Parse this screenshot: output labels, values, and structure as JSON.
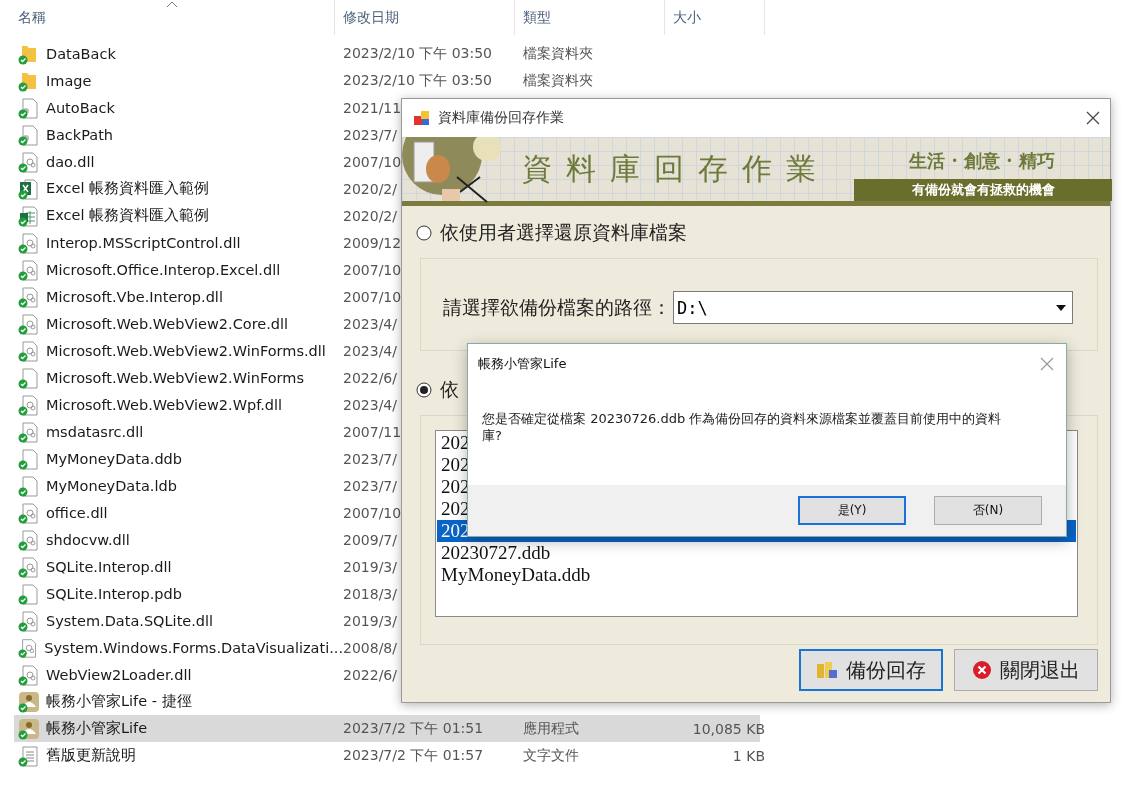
{
  "explorer": {
    "columns": [
      {
        "label": "名稱",
        "sorted": true
      },
      {
        "label": "修改日期"
      },
      {
        "label": "類型"
      },
      {
        "label": "大小"
      }
    ],
    "rows": [
      {
        "kind": "folder",
        "name": "DataBack",
        "date": "2023/2/10 下午 03:50",
        "type": "檔案資料夾",
        "selected": false
      },
      {
        "kind": "folder",
        "name": "Image",
        "date": "2023/2/10 下午 03:50",
        "type": "檔案資料夾",
        "selected": false
      },
      {
        "kind": "file",
        "name": "AutoBack",
        "date": "2021/11",
        "selected": false
      },
      {
        "kind": "file",
        "name": "BackPath",
        "date": "2023/7/",
        "selected": false
      },
      {
        "kind": "dll",
        "name": "dao.dll",
        "date": "2007/10",
        "selected": false
      },
      {
        "kind": "excel",
        "name": "Excel 帳務資料匯入範例",
        "date": "2020/2/",
        "selected": false
      },
      {
        "kind": "sheet",
        "name": "Excel 帳務資料匯入範例",
        "date": "2020/2/",
        "selected": false
      },
      {
        "kind": "dll",
        "name": "Interop.MSScriptControl.dll",
        "date": "2009/12",
        "selected": false
      },
      {
        "kind": "dll",
        "name": "Microsoft.Office.Interop.Excel.dll",
        "date": "2007/10",
        "selected": false
      },
      {
        "kind": "dll",
        "name": "Microsoft.Vbe.Interop.dll",
        "date": "2007/10",
        "selected": false
      },
      {
        "kind": "dll",
        "name": "Microsoft.Web.WebView2.Core.dll",
        "date": "2023/4/",
        "selected": false
      },
      {
        "kind": "dll",
        "name": "Microsoft.Web.WebView2.WinForms.dll",
        "date": "2023/4/",
        "selected": false
      },
      {
        "kind": "blank",
        "name": "Microsoft.Web.WebView2.WinForms",
        "date": "2022/6/",
        "selected": false
      },
      {
        "kind": "dll",
        "name": "Microsoft.Web.WebView2.Wpf.dll",
        "date": "2023/4/",
        "selected": false
      },
      {
        "kind": "dll",
        "name": "msdatasrc.dll",
        "date": "2007/11",
        "selected": false
      },
      {
        "kind": "blank",
        "name": "MyMoneyData.ddb",
        "date": "2023/7/",
        "selected": false
      },
      {
        "kind": "blank",
        "name": "MyMoneyData.ldb",
        "date": "2023/7/",
        "selected": false
      },
      {
        "kind": "dll",
        "name": "office.dll",
        "date": "2007/10",
        "selected": false
      },
      {
        "kind": "dll",
        "name": "shdocvw.dll",
        "date": "2009/7/",
        "selected": false
      },
      {
        "kind": "dll",
        "name": "SQLite.Interop.dll",
        "date": "2019/3/",
        "selected": false
      },
      {
        "kind": "blank",
        "name": "SQLite.Interop.pdb",
        "date": "2018/3/",
        "selected": false
      },
      {
        "kind": "dll",
        "name": "System.Data.SQLite.dll",
        "date": "2019/3/",
        "selected": false
      },
      {
        "kind": "dll",
        "name": "System.Windows.Forms.DataVisualizati...",
        "date": "2008/8/",
        "selected": false
      },
      {
        "kind": "dll",
        "name": "WebView2Loader.dll",
        "date": "2022/6/",
        "selected": false
      },
      {
        "kind": "app",
        "name": "帳務小管家Life - 捷徑",
        "selected": false
      },
      {
        "kind": "app",
        "name": "帳務小管家Life",
        "date": "2023/7/2 下午 01:51",
        "type": "應用程式",
        "size": "10,085 KB",
        "selected": true
      },
      {
        "kind": "text",
        "name": "舊版更新說明",
        "date": "2023/7/2 下午 01:57",
        "type": "文字文件",
        "size": "1 KB",
        "selected": false
      }
    ]
  },
  "dialog": {
    "title": "資料庫備份回存作業",
    "banner": {
      "heading": "資料庫回存作業",
      "slogan": "生活 · 創意 · 精巧",
      "tagline": "有備份就會有拯救的機會"
    },
    "options": [
      {
        "label": "依使用者選擇還原資料庫檔案",
        "selected": false
      },
      {
        "label": "依",
        "selected": true
      }
    ],
    "path_label": "請選擇欲備份檔案的路徑：",
    "path_value": "D:\\",
    "files": [
      {
        "name": "202",
        "selected": false
      },
      {
        "name": "202",
        "selected": false
      },
      {
        "name": "202",
        "selected": false
      },
      {
        "name": "202",
        "selected": false
      },
      {
        "name": "202",
        "selected": true
      },
      {
        "name": "20230727.ddb",
        "selected": false
      },
      {
        "name": "MyMoneyData.ddb",
        "selected": false
      }
    ],
    "buttons": [
      {
        "kind": "restore",
        "label": "備份回存",
        "focused": true
      },
      {
        "kind": "close",
        "label": "關閉退出",
        "focused": false
      }
    ]
  },
  "message_box": {
    "title": "帳務小管家Life",
    "message": "您是否確定從檔案 20230726.ddb 作為備份回存的資料來源檔案並覆蓋目前使用中的資料庫?",
    "buttons": [
      {
        "label": "是(Y)",
        "focused": true
      },
      {
        "label": "否(N)",
        "focused": false
      }
    ]
  }
}
